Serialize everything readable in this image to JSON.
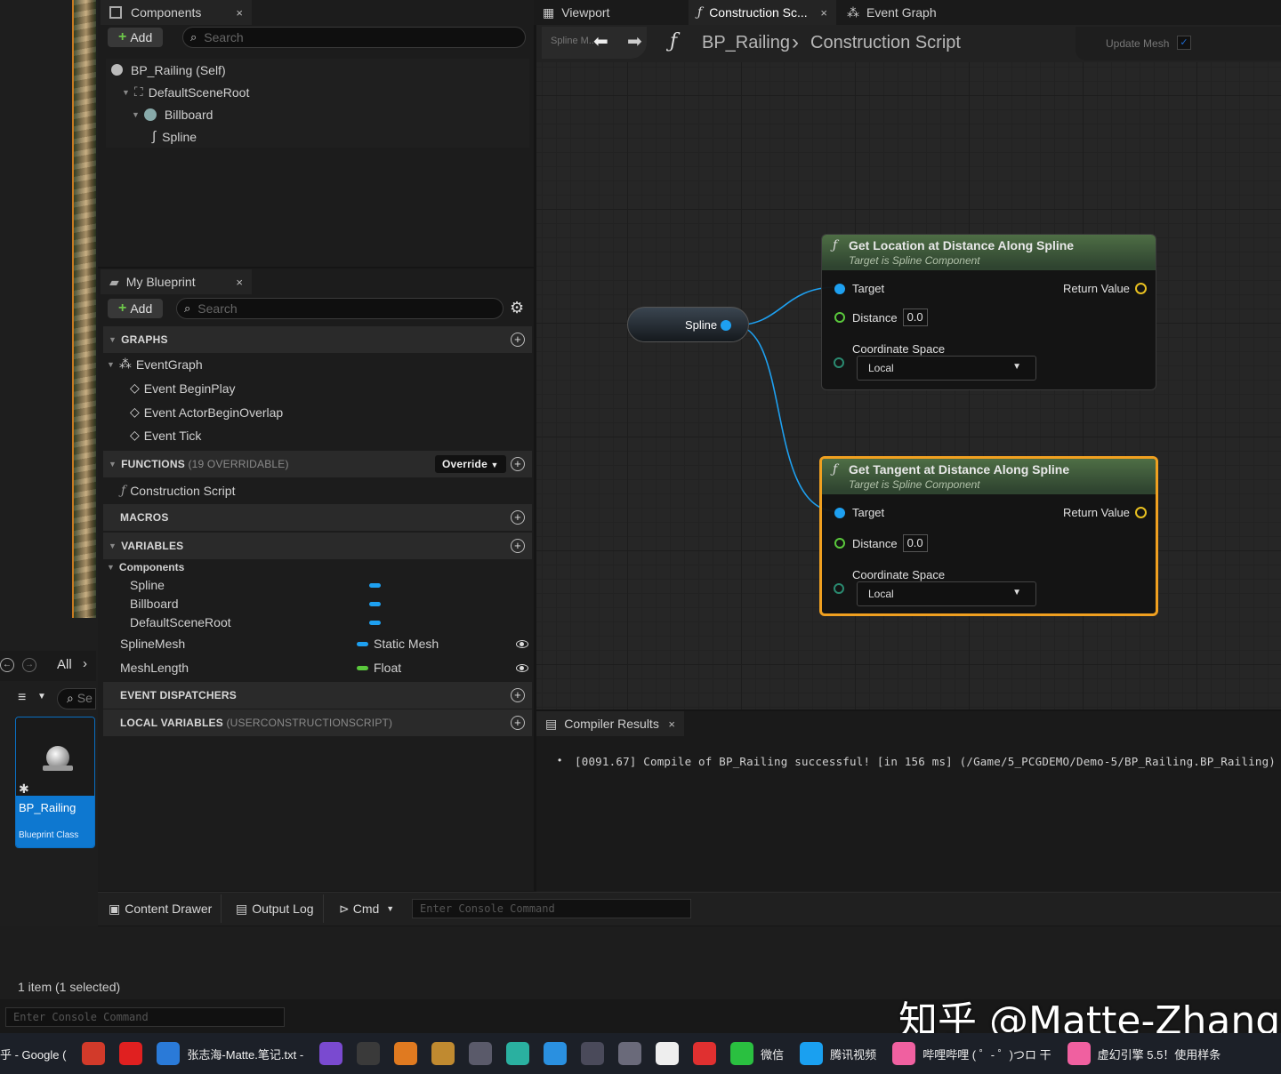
{
  "components": {
    "tab_label": "Components",
    "close": "×",
    "add_label": "Add",
    "search_placeholder": "Search",
    "tree": [
      {
        "label": "BP_Railing (Self)"
      },
      {
        "label": "DefaultSceneRoot"
      },
      {
        "label": "Billboard"
      },
      {
        "label": "Spline"
      }
    ]
  },
  "my_blueprint": {
    "tab_label": "My Blueprint",
    "close": "×",
    "add_label": "Add",
    "search_placeholder": "Search",
    "graphs": {
      "header": "GRAPHS",
      "items": [
        "EventGraph",
        "Event BeginPlay",
        "Event ActorBeginOverlap",
        "Event Tick"
      ]
    },
    "functions": {
      "header": "FUNCTIONS",
      "count": "(19 OVERRIDABLE)",
      "override_label": "Override",
      "items": [
        "Construction Script"
      ]
    },
    "macros": {
      "header": "MACROS"
    },
    "variables": {
      "header": "VARIABLES",
      "group": "Components",
      "group_items": [
        "Spline",
        "Billboard",
        "DefaultSceneRoot"
      ],
      "items": [
        {
          "name": "SplineMesh",
          "type": "Static Mesh",
          "color": "#1ea0f0"
        },
        {
          "name": "MeshLength",
          "type": "Float",
          "color": "#5ac83c"
        }
      ]
    },
    "dispatchers": {
      "header": "EVENT DISPATCHERS"
    },
    "locals": {
      "header": "LOCAL VARIABLES",
      "scope": "(USERCONSTRUCTIONSCRIPT)"
    }
  },
  "graph_tabs": [
    {
      "label": "Viewport"
    },
    {
      "label": "Construction Sc..."
    },
    {
      "label": "Event Graph"
    }
  ],
  "graph_header": {
    "breadcrumb_root": "BP_Railing",
    "breadcrumb_sep": "›",
    "breadcrumb_leaf": "Construction Script",
    "update_mesh": "Update Mesh",
    "mini_label": "Spline M..."
  },
  "nodes": {
    "spline_var": {
      "label": "Spline"
    },
    "get_location": {
      "title": "Get Location at Distance Along Spline",
      "subtitle": "Target is Spline Component",
      "target": "Target",
      "return_value": "Return Value",
      "distance": "Distance",
      "distance_value": "0.0",
      "coord_space": "Coordinate Space",
      "coord_value": "Local"
    },
    "get_tangent": {
      "title": "Get Tangent at Distance Along Spline",
      "subtitle": "Target is Spline Component",
      "target": "Target",
      "return_value": "Return Value",
      "distance": "Distance",
      "distance_value": "0.0",
      "coord_space": "Coordinate Space",
      "coord_value": "Local"
    }
  },
  "compiler": {
    "tab_label": "Compiler Results",
    "close": "×",
    "message": "[0091.67] Compile of BP_Railing successful! [in 156 ms] (/Game/5_PCGDEMO/Demo-5/BP_Railing.BP_Railing)"
  },
  "content_browser": {
    "nav_label": "All",
    "filter_search": "Se",
    "asset_name": "BP_Railing",
    "asset_type": "Blueprint Class",
    "status": "1 item (1 selected)"
  },
  "bottom_bar": {
    "content_drawer": "Content Drawer",
    "output_log": "Output Log",
    "cmd": "Cmd",
    "console_placeholder": "Enter Console Command"
  },
  "console2_placeholder": "Enter Console Command",
  "watermark": "知乎 @Matte-Zhang",
  "taskbar": [
    {
      "label": "乎 - Google (",
      "color": ""
    },
    {
      "label": "",
      "color": "#d23a2a"
    },
    {
      "label": "",
      "color": "#e02020"
    },
    {
      "label": "张志海-Matte.笔记.txt -",
      "color": "#2a7ad8"
    },
    {
      "label": "",
      "color": "#7a4ad0"
    },
    {
      "label": "",
      "color": "#3a3a3a"
    },
    {
      "label": "",
      "color": "#e07a20"
    },
    {
      "label": "",
      "color": "#c08a30"
    },
    {
      "label": "",
      "color": "#5a5a6a"
    },
    {
      "label": "",
      "color": "#2ab0a0"
    },
    {
      "label": "",
      "color": "#2a90e0"
    },
    {
      "label": "",
      "color": "#4a4a5a"
    },
    {
      "label": "",
      "color": "#6a6a7a"
    },
    {
      "label": "",
      "color": "#eeeeee"
    },
    {
      "label": "",
      "color": "#e03030"
    },
    {
      "label": "微信",
      "color": "#2ac040"
    },
    {
      "label": "腾讯视频",
      "color": "#1aa0f0"
    },
    {
      "label": "哔哩哔哩 ( ゜- ゜)つロ 干",
      "color": "#f060a0"
    },
    {
      "label": "虚幻引擎 5.5！使用样条",
      "color": "#f060a0"
    }
  ]
}
